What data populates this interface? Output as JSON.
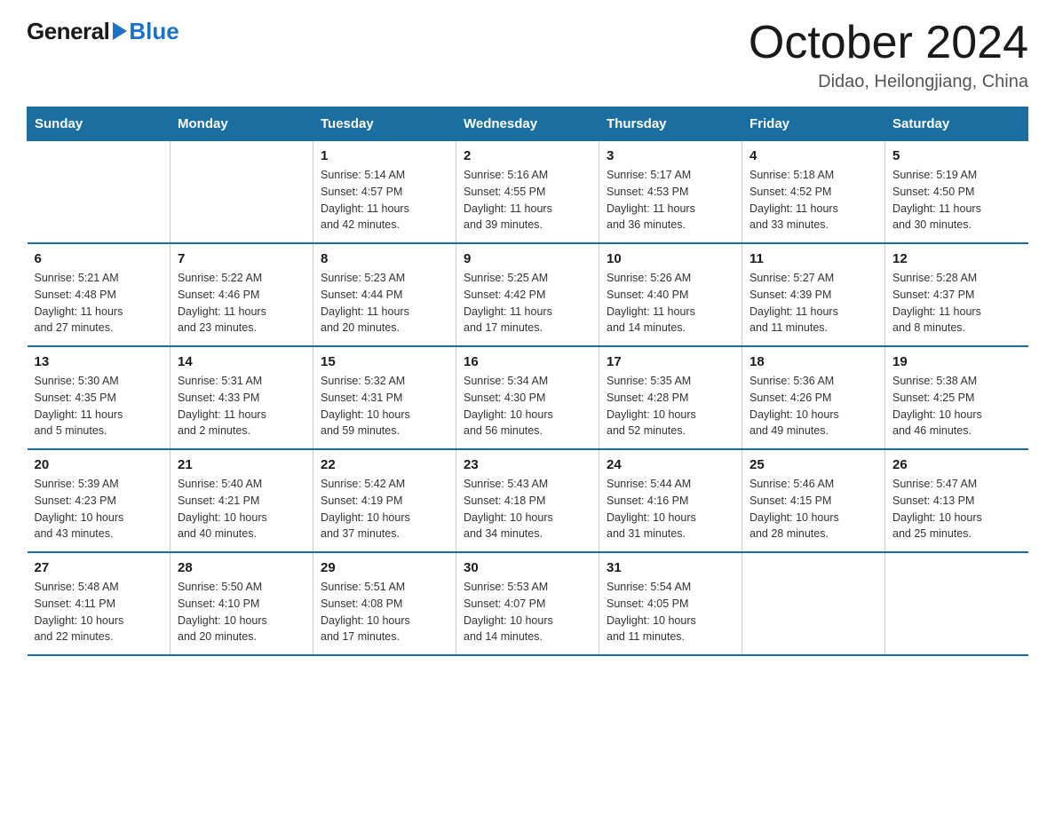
{
  "logo": {
    "general": "General",
    "blue": "Blue"
  },
  "title": "October 2024",
  "subtitle": "Didao, Heilongjiang, China",
  "headers": [
    "Sunday",
    "Monday",
    "Tuesday",
    "Wednesday",
    "Thursday",
    "Friday",
    "Saturday"
  ],
  "weeks": [
    [
      {
        "day": "",
        "info": ""
      },
      {
        "day": "",
        "info": ""
      },
      {
        "day": "1",
        "info": "Sunrise: 5:14 AM\nSunset: 4:57 PM\nDaylight: 11 hours\nand 42 minutes."
      },
      {
        "day": "2",
        "info": "Sunrise: 5:16 AM\nSunset: 4:55 PM\nDaylight: 11 hours\nand 39 minutes."
      },
      {
        "day": "3",
        "info": "Sunrise: 5:17 AM\nSunset: 4:53 PM\nDaylight: 11 hours\nand 36 minutes."
      },
      {
        "day": "4",
        "info": "Sunrise: 5:18 AM\nSunset: 4:52 PM\nDaylight: 11 hours\nand 33 minutes."
      },
      {
        "day": "5",
        "info": "Sunrise: 5:19 AM\nSunset: 4:50 PM\nDaylight: 11 hours\nand 30 minutes."
      }
    ],
    [
      {
        "day": "6",
        "info": "Sunrise: 5:21 AM\nSunset: 4:48 PM\nDaylight: 11 hours\nand 27 minutes."
      },
      {
        "day": "7",
        "info": "Sunrise: 5:22 AM\nSunset: 4:46 PM\nDaylight: 11 hours\nand 23 minutes."
      },
      {
        "day": "8",
        "info": "Sunrise: 5:23 AM\nSunset: 4:44 PM\nDaylight: 11 hours\nand 20 minutes."
      },
      {
        "day": "9",
        "info": "Sunrise: 5:25 AM\nSunset: 4:42 PM\nDaylight: 11 hours\nand 17 minutes."
      },
      {
        "day": "10",
        "info": "Sunrise: 5:26 AM\nSunset: 4:40 PM\nDaylight: 11 hours\nand 14 minutes."
      },
      {
        "day": "11",
        "info": "Sunrise: 5:27 AM\nSunset: 4:39 PM\nDaylight: 11 hours\nand 11 minutes."
      },
      {
        "day": "12",
        "info": "Sunrise: 5:28 AM\nSunset: 4:37 PM\nDaylight: 11 hours\nand 8 minutes."
      }
    ],
    [
      {
        "day": "13",
        "info": "Sunrise: 5:30 AM\nSunset: 4:35 PM\nDaylight: 11 hours\nand 5 minutes."
      },
      {
        "day": "14",
        "info": "Sunrise: 5:31 AM\nSunset: 4:33 PM\nDaylight: 11 hours\nand 2 minutes."
      },
      {
        "day": "15",
        "info": "Sunrise: 5:32 AM\nSunset: 4:31 PM\nDaylight: 10 hours\nand 59 minutes."
      },
      {
        "day": "16",
        "info": "Sunrise: 5:34 AM\nSunset: 4:30 PM\nDaylight: 10 hours\nand 56 minutes."
      },
      {
        "day": "17",
        "info": "Sunrise: 5:35 AM\nSunset: 4:28 PM\nDaylight: 10 hours\nand 52 minutes."
      },
      {
        "day": "18",
        "info": "Sunrise: 5:36 AM\nSunset: 4:26 PM\nDaylight: 10 hours\nand 49 minutes."
      },
      {
        "day": "19",
        "info": "Sunrise: 5:38 AM\nSunset: 4:25 PM\nDaylight: 10 hours\nand 46 minutes."
      }
    ],
    [
      {
        "day": "20",
        "info": "Sunrise: 5:39 AM\nSunset: 4:23 PM\nDaylight: 10 hours\nand 43 minutes."
      },
      {
        "day": "21",
        "info": "Sunrise: 5:40 AM\nSunset: 4:21 PM\nDaylight: 10 hours\nand 40 minutes."
      },
      {
        "day": "22",
        "info": "Sunrise: 5:42 AM\nSunset: 4:19 PM\nDaylight: 10 hours\nand 37 minutes."
      },
      {
        "day": "23",
        "info": "Sunrise: 5:43 AM\nSunset: 4:18 PM\nDaylight: 10 hours\nand 34 minutes."
      },
      {
        "day": "24",
        "info": "Sunrise: 5:44 AM\nSunset: 4:16 PM\nDaylight: 10 hours\nand 31 minutes."
      },
      {
        "day": "25",
        "info": "Sunrise: 5:46 AM\nSunset: 4:15 PM\nDaylight: 10 hours\nand 28 minutes."
      },
      {
        "day": "26",
        "info": "Sunrise: 5:47 AM\nSunset: 4:13 PM\nDaylight: 10 hours\nand 25 minutes."
      }
    ],
    [
      {
        "day": "27",
        "info": "Sunrise: 5:48 AM\nSunset: 4:11 PM\nDaylight: 10 hours\nand 22 minutes."
      },
      {
        "day": "28",
        "info": "Sunrise: 5:50 AM\nSunset: 4:10 PM\nDaylight: 10 hours\nand 20 minutes."
      },
      {
        "day": "29",
        "info": "Sunrise: 5:51 AM\nSunset: 4:08 PM\nDaylight: 10 hours\nand 17 minutes."
      },
      {
        "day": "30",
        "info": "Sunrise: 5:53 AM\nSunset: 4:07 PM\nDaylight: 10 hours\nand 14 minutes."
      },
      {
        "day": "31",
        "info": "Sunrise: 5:54 AM\nSunset: 4:05 PM\nDaylight: 10 hours\nand 11 minutes."
      },
      {
        "day": "",
        "info": ""
      },
      {
        "day": "",
        "info": ""
      }
    ]
  ]
}
